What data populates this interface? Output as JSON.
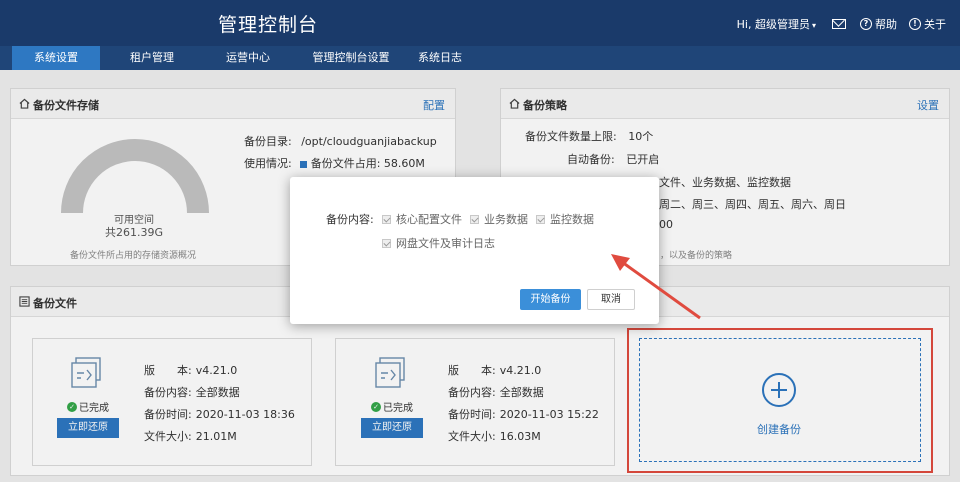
{
  "header": {
    "title": "管理控制台",
    "greeting": "Hi, 超级管理员",
    "help_label": "帮助",
    "about_label": "关于"
  },
  "nav": {
    "tabs": [
      {
        "label": "系统设置",
        "active": true
      },
      {
        "label": "租户管理",
        "active": false
      },
      {
        "label": "运营中心",
        "active": false
      },
      {
        "label": "管理控制台设置",
        "active": false
      },
      {
        "label": "系统日志",
        "active": false
      }
    ]
  },
  "storage_panel": {
    "title": "备份文件存储",
    "action_label": "配置",
    "dir_label": "备份目录:",
    "dir_value": "/opt/cloudguanjiabackup",
    "usage_label": "使用情况:",
    "usage_legend": "备份文件占用: 58.60M",
    "gauge_label": "可用空间",
    "gauge_total": "共261.39G",
    "caption": "备份文件所占用的存储资源概况"
  },
  "policy_panel": {
    "title": "备份策略",
    "action_label": "设置",
    "max_files_label": "备份文件数量上限:",
    "max_files_value": "10个",
    "auto_label": "自动备份:",
    "auto_value": "已开启",
    "content_partial": "文件、业务数据、监控数据",
    "days_partial": "周二、周三、周四、周五、周六、周日",
    "time_partial": "00",
    "caption_partial": "，以及备份的策略"
  },
  "files_panel": {
    "title": "备份文件",
    "cards": [
      {
        "version_label": "版　　本:",
        "version": "v4.21.0",
        "content_label": "备份内容:",
        "content": "全部数据",
        "time_label": "备份时间:",
        "time": "2020-11-03 18:36",
        "size_label": "文件大小:",
        "size": "21.01M",
        "status": "已完成",
        "restore_label": "立即还原"
      },
      {
        "version_label": "版　　本:",
        "version": "v4.21.0",
        "content_label": "备份内容:",
        "content": "全部数据",
        "time_label": "备份时间:",
        "time": "2020-11-03 15:22",
        "size_label": "文件大小:",
        "size": "16.03M",
        "status": "已完成",
        "restore_label": "立即还原"
      }
    ],
    "create_label": "创建备份"
  },
  "modal": {
    "content_label": "备份内容:",
    "options": [
      {
        "label": "核心配置文件",
        "checked": true
      },
      {
        "label": "业务数据",
        "checked": true
      },
      {
        "label": "监控数据",
        "checked": true
      },
      {
        "label": "网盘文件及审计日志",
        "checked": true
      }
    ],
    "start_label": "开始备份",
    "cancel_label": "取消"
  },
  "colors": {
    "header_bg": "#1a3a6a",
    "accent": "#2e78c2",
    "highlight": "#e04b3f",
    "success": "#35a84a"
  }
}
